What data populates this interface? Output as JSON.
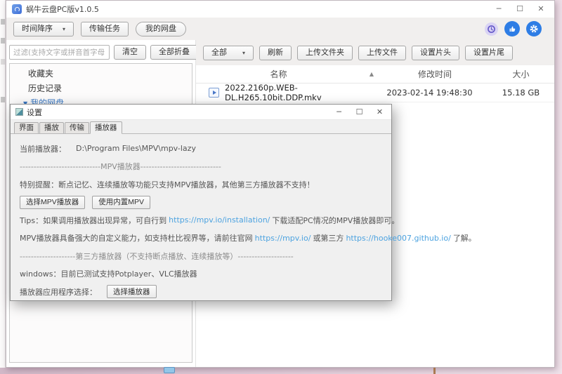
{
  "desktop": {
    "bg_color": "#dcc3d1"
  },
  "main_window": {
    "title": "蜗牛云盘PC版v1.0.5",
    "window_controls": {
      "minimize": "─",
      "maximize": "☐",
      "close": "✕"
    },
    "toolbar": {
      "sort_dropdown": "时间降序",
      "dropdown_arrow": "▾",
      "transfer_tasks": "传输任务",
      "my_drive": "我的网盘"
    },
    "sidebar": {
      "filter_placeholder": "过滤(支持文字或拼音首字母)",
      "clear": "清空",
      "collapse_all": "全部折叠",
      "items": [
        {
          "label": "收藏夹"
        },
        {
          "label": "历史记录"
        },
        {
          "label": "我的网盘",
          "arrow": "▼"
        }
      ]
    },
    "file_toolbar": {
      "filter_all": "全部",
      "dropdown_arrow": "▾",
      "refresh": "刷新",
      "upload_folder": "上传文件夹",
      "upload_file": "上传文件",
      "set_intro": "设置片头",
      "set_outro": "设置片尾"
    },
    "file_table": {
      "col_name": "名称",
      "sort_asc": "▲",
      "col_modified": "修改时间",
      "col_size": "大小",
      "rows": [
        {
          "name": "2022.2160p.WEB-DL.H265.10bit.DDP.mkv",
          "modified": "2023-02-14 19:48:30",
          "size": "15.18 GB"
        }
      ]
    }
  },
  "settings_dialog": {
    "title": "设置",
    "window_controls": {
      "minimize": "─",
      "maximize": "☐",
      "close": "✕"
    },
    "tabs": [
      "界面",
      "播放",
      "传输",
      "播放器"
    ],
    "current_player_label": "当前播放器：",
    "current_player_path": "D:\\Program Files\\MPV\\mpv-lazy",
    "mpv_separator": "-----------------------------MPV播放器-----------------------------",
    "reminder": "特别提醒：断点记忆、连续播放等功能只支持MPV播放器，其他第三方播放器不支持！",
    "choose_mpv_button": "选择MPV播放器",
    "builtin_mpv_button": "使用内置MPV",
    "tips_prefix": "Tips：如果调用播放器出现异常，可自行到",
    "tips_link": "https://mpv.io/installation/",
    "tips_suffix": "下载适配PC情况的MPV播放器即可。",
    "mpv_info_prefix": "MPV播放器具备强大的自定义能力，如支持杜比视界等，请前往官网",
    "mpv_link": "https://mpv.io/",
    "mpv_info_middle": "或第三方",
    "hooke_link": "https://hooke007.github.io/",
    "mpv_info_suffix": "了解。",
    "third_party_separator": "--------------------第三方播放器（不支持断点播放、连续播放等）--------------------",
    "windows_support": "windows：目前已测试支持Potplayer、VLC播放器",
    "player_select_label": "播放器应用程序选择：",
    "choose_player_button": "选择播放器"
  }
}
